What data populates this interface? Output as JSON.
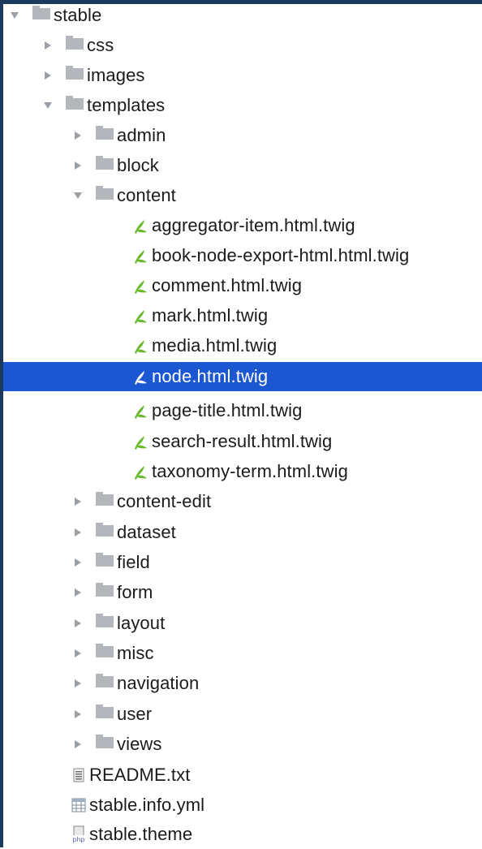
{
  "tree": {
    "root": {
      "label": "stable",
      "expanded": true
    },
    "css": {
      "label": "css",
      "expanded": false
    },
    "images": {
      "label": "images",
      "expanded": false
    },
    "templates": {
      "label": "templates",
      "expanded": true
    },
    "admin": {
      "label": "admin",
      "expanded": false
    },
    "block": {
      "label": "block",
      "expanded": false
    },
    "content": {
      "label": "content",
      "expanded": true
    },
    "content_files": [
      {
        "label": "aggregator-item.html.twig",
        "icon": "twig-icon",
        "selected": false
      },
      {
        "label": "book-node-export-html.html.twig",
        "icon": "twig-icon",
        "selected": false
      },
      {
        "label": "comment.html.twig",
        "icon": "twig-icon",
        "selected": false
      },
      {
        "label": "mark.html.twig",
        "icon": "twig-icon",
        "selected": false
      },
      {
        "label": "media.html.twig",
        "icon": "twig-icon",
        "selected": false
      },
      {
        "label": "node.html.twig",
        "icon": "twig-icon",
        "selected": true
      },
      {
        "label": "page-title.html.twig",
        "icon": "twig-icon",
        "selected": false
      },
      {
        "label": "search-result.html.twig",
        "icon": "twig-icon",
        "selected": false
      },
      {
        "label": "taxonomy-term.html.twig",
        "icon": "twig-icon",
        "selected": false
      }
    ],
    "template_folders": [
      {
        "label": "content-edit",
        "expanded": false
      },
      {
        "label": "dataset",
        "expanded": false
      },
      {
        "label": "field",
        "expanded": false
      },
      {
        "label": "form",
        "expanded": false
      },
      {
        "label": "layout",
        "expanded": false
      },
      {
        "label": "misc",
        "expanded": false
      },
      {
        "label": "navigation",
        "expanded": false
      },
      {
        "label": "user",
        "expanded": false
      },
      {
        "label": "views",
        "expanded": false
      }
    ],
    "root_files": [
      {
        "label": "README.txt",
        "icon": "text-file-icon"
      },
      {
        "label": "stable.info.yml",
        "icon": "yml-file-icon"
      },
      {
        "label": "stable.theme",
        "icon": "php-file-icon",
        "icon_text": "php"
      }
    ]
  },
  "colors": {
    "selection": "#1a57d0",
    "folder": "#b3b7bc",
    "twig": "#6ab82c",
    "frame": "#1c3a5e"
  }
}
